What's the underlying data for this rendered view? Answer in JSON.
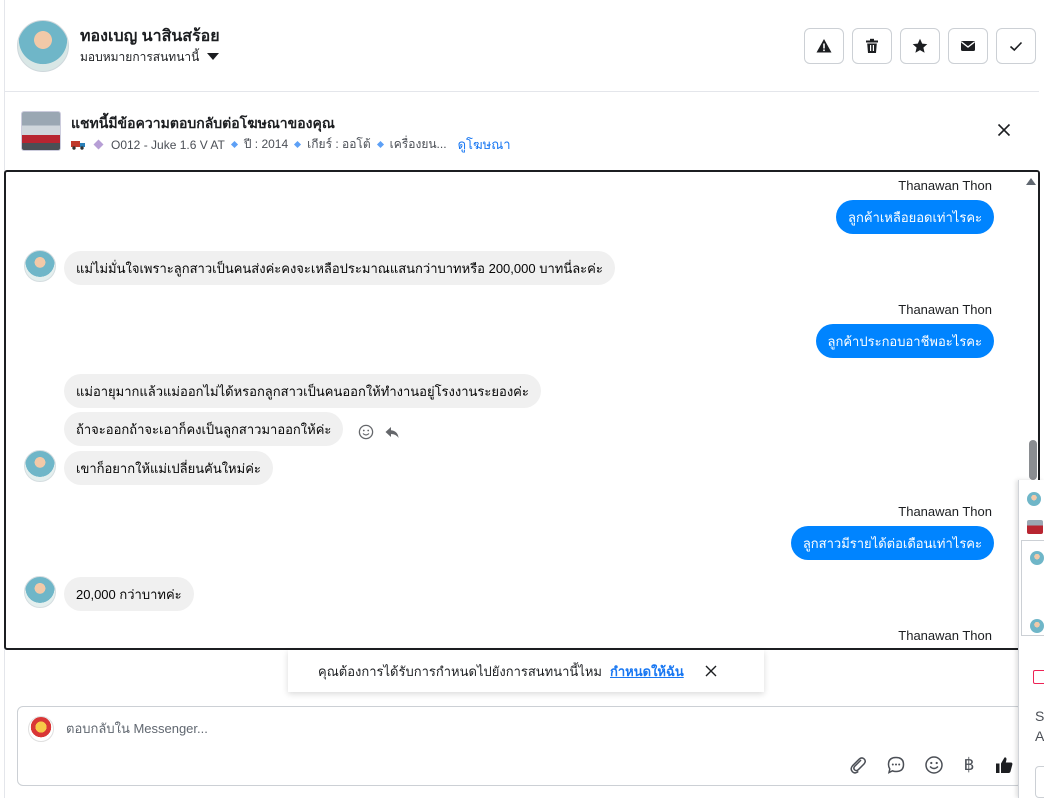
{
  "header": {
    "contact_name": "ทองเบญ นาสินสร้อย",
    "assign_label": "มอบหมายการสนทนานี้"
  },
  "ad": {
    "title": "แชทนี้มีข้อความตอบกลับต่อโฆษณาของคุณ",
    "meta": [
      "O012 - Juke 1.6 V AT",
      "ปี : 2014",
      "เกียร์ : ออโต้",
      "เครื่องยน..."
    ],
    "view_link": "ดูโฆษณา"
  },
  "messages": {
    "m1_sender": "Thanawan Thon",
    "m1_text": "ลูกค้าเหลือยอดเท่าไรคะ",
    "m2_text": "แม่ไม่มั่นใจเพราะลูกสาวเป็นคนส่งค่ะคงจะเหลือประมาณแสนกว่าบาทหรือ 200,000 บาทนี่ละค่ะ",
    "m3_sender": "Thanawan Thon",
    "m3_text": "ลูกค้าประกอบอาชีพอะไรคะ",
    "m4_text": "แม่อายุมากแล้วแม่ออกไม่ได้หรอกลูกสาวเป็นคนออกให้ทำงานอยู่โรงงานระยองค่ะ",
    "m5_text": "ถ้าจะออกถ้าจะเอาก็คงเป็นลูกสาวมาออกให้ค่ะ",
    "m6_text": "เขาก็อยากให้แม่เปลี่ยนคันใหม่ค่ะ",
    "m7_sender": "Thanawan Thon",
    "m7_text": "ลูกสาวมีรายได้ต่อเดือนเท่าไรคะ",
    "m8_text": "20,000 กว่าบาทค่ะ",
    "m9_sender": "Thanawan Thon"
  },
  "toast": {
    "text": "คุณต้องการได้รับการกำหนดไปยังการสนทนานี้ไหม",
    "link": "กำหนดให้ฉัน"
  },
  "composer": {
    "placeholder": "ตอบกลับใน Messenger...",
    "currency_symbol": "฿"
  },
  "side_strip": {
    "text_line1": "So",
    "text_line2": "A"
  },
  "colors": {
    "outgoing_bubble": "#0084ff",
    "incoming_bubble": "#f0f0f0",
    "link": "#1877f2"
  }
}
